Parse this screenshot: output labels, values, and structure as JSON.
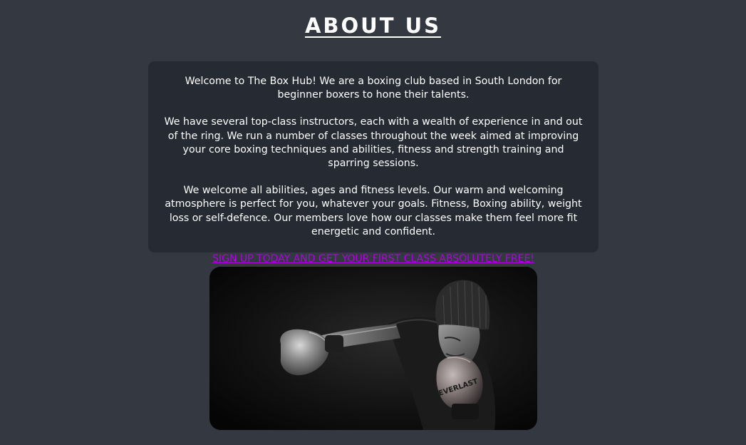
{
  "page": {
    "heading": "ABOUT US"
  },
  "about": {
    "paragraph_1": "Welcome to The Box Hub! We are a boxing club based in South London for beginner boxers to hone their talents.",
    "paragraph_2": "We have several top-class instructors, each with a wealth of experience in and out of the ring. We run a number of classes throughout the week aimed at improving your core boxing techniques and abilities, fitness and strength training and sparring sessions.",
    "paragraph_3": "We welcome all abilities, ages and fitness levels. Our warm and welcoming atmosphere is perfect for you, whatever your goals. Fitness, Boxing ability, weight loss or self-defence. Our members love how our classes make them feel more fit energetic and confident.",
    "cta_link": "SIGN UP TODAY AND GET YOUR FIRST CLASS ABSOLUTELY FREE!"
  },
  "image": {
    "glove_brand": "EVERLAST"
  },
  "colors": {
    "page_background": "#333841",
    "card_background": "#262a33",
    "text": "#ffffff",
    "link": "#b300e6"
  }
}
